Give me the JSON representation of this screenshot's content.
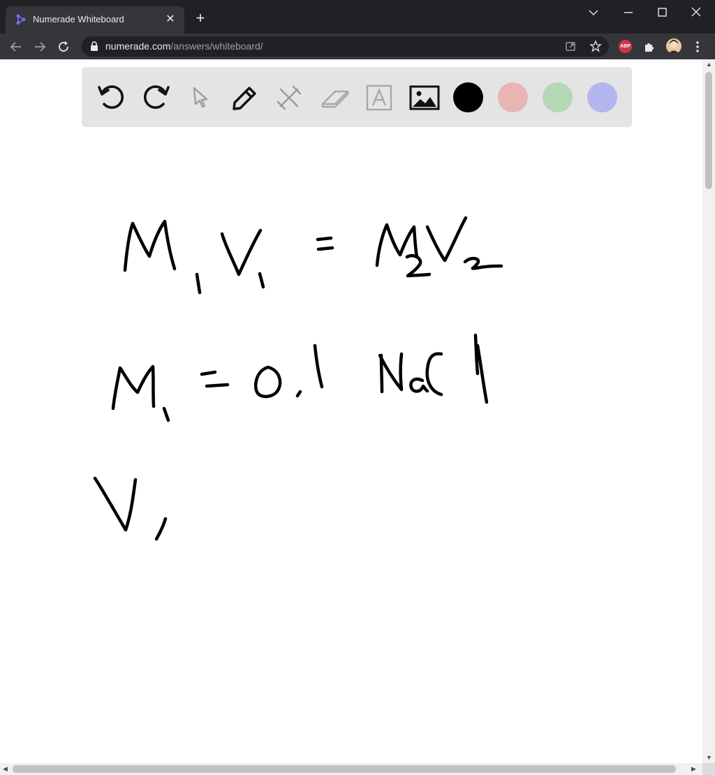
{
  "browser": {
    "tab_title": "Numerade Whiteboard",
    "url_host": "numerade.com",
    "url_path": "/answers/whiteboard/",
    "abp_label": "ABP",
    "icons": [
      "favicon-icon",
      "close-icon",
      "plus-icon",
      "minimize-icon",
      "maximize-icon",
      "window-close-icon",
      "back-icon",
      "forward-icon",
      "reload-icon",
      "lock-icon",
      "share-icon",
      "star-icon",
      "puzzle-icon",
      "kebab-menu-icon"
    ]
  },
  "whiteboard": {
    "tools": [
      "undo-icon",
      "redo-icon",
      "select-pointer-icon",
      "pen-icon",
      "tools-crossed-icon",
      "eraser-icon",
      "text-icon",
      "image-icon"
    ],
    "colors": {
      "black": "#000000",
      "red": "#e8b4b4",
      "green": "#b4d8b4",
      "blue": "#b4b4ee"
    },
    "handwritten_lines": [
      "M₁V₁ = M₂V₂",
      "M₁ = 0.1 NaCl",
      "V₁"
    ]
  }
}
